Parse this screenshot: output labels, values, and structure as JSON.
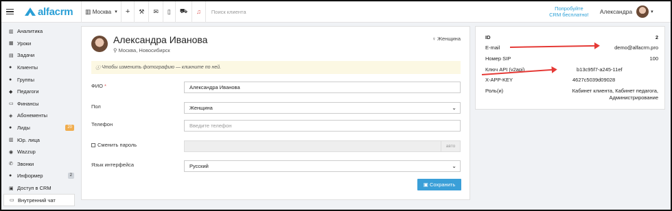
{
  "header": {
    "brand": "alfacrm",
    "city": "Москва",
    "search_placeholder": "Поиск клиента",
    "promo_line1": "Попробуйте",
    "promo_line2": "CRM бесплатно!",
    "user_name": "Александра"
  },
  "sidebar": {
    "items": [
      {
        "label": "Аналитика",
        "icon": "chart-icon"
      },
      {
        "label": "Уроки",
        "icon": "calendar-icon"
      },
      {
        "label": "Задачи",
        "icon": "tasks-icon"
      },
      {
        "label": "Клиенты",
        "icon": "user-icon"
      },
      {
        "label": "Группы",
        "icon": "users-icon"
      },
      {
        "label": "Педагоги",
        "icon": "graduation-cap-icon"
      },
      {
        "label": "Финансы",
        "icon": "money-icon"
      },
      {
        "label": "Абонементы",
        "icon": "tag-icon"
      },
      {
        "label": "Лиды",
        "icon": "user-plus-icon",
        "badge": "20"
      },
      {
        "label": "Юр. лица",
        "icon": "building-icon"
      },
      {
        "label": "Wazzup",
        "icon": "whatsapp-icon"
      },
      {
        "label": "Звонки",
        "icon": "phone-icon"
      },
      {
        "label": "Информер",
        "icon": "bell-icon",
        "badge": "2"
      },
      {
        "label": "Доступ в CRM",
        "icon": "lock-icon"
      },
      {
        "label": "Внутренний чат",
        "icon": "chat-icon"
      }
    ]
  },
  "profile": {
    "name": "Александра Иванова",
    "location": "Москва, Новосибирск",
    "gender_tag": "Женщина",
    "notice": "Чтобы изменить фотографию — кликните по ней."
  },
  "form": {
    "fio_label": "ФИО",
    "fio_value": "Александра Иванова",
    "gender_label": "Пол",
    "gender_value": "Женщина",
    "phone_label": "Телефон",
    "phone_placeholder": "Введите телефон",
    "change_password_label": "Сменить пароль",
    "autogen_label": "авто",
    "language_label": "Язык интерфейса",
    "language_value": "Русский",
    "save_label": "Сохранить"
  },
  "info": {
    "id_label": "ID",
    "id_value": "2",
    "email_label": "E-mail",
    "email_value": "demo@alfacrm.pro",
    "sip_label": "Номер SIP",
    "sip_value": "100",
    "api_label": "Ключ API (v2api)",
    "api_value": "b13c95f7-a245-11ef",
    "xapp_label": "X-APP-KEY",
    "xapp_value": "4627c5039d09028",
    "roles_label": "Роль(и)",
    "roles_value_line1": "Кабинет клиента, Кабинет педагога,",
    "roles_value_line2": "Администрирование"
  },
  "colors": {
    "accent": "#2a9fd6",
    "save_button": "#3a9fd8",
    "notice_bg": "#fcf8e3",
    "arrow": "#e53935",
    "badge_orange": "#f0ad4e"
  }
}
